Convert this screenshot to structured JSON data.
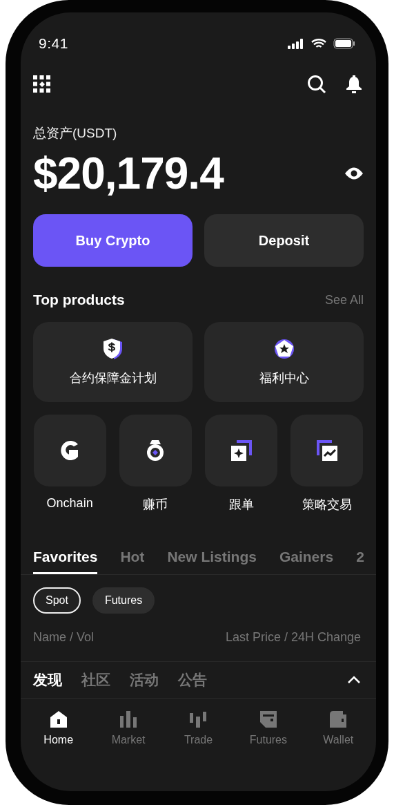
{
  "status_bar": {
    "time": "9:41"
  },
  "balance": {
    "label": "总资产(USDT)",
    "amount": "$20,179.4"
  },
  "actions": [
    {
      "label": "Buy Crypto",
      "kind": "primary"
    },
    {
      "label": "Deposit",
      "kind": "secondary"
    }
  ],
  "top_products": {
    "title": "Top products",
    "see_all": "See All",
    "featured": [
      {
        "label": "合约保障金计划"
      },
      {
        "label": "福利中心"
      }
    ],
    "shortcuts": [
      {
        "label": "Onchain"
      },
      {
        "label": "赚币"
      },
      {
        "label": "跟单"
      },
      {
        "label": "策略交易"
      }
    ]
  },
  "market_tabs": [
    {
      "label": "Favorites",
      "selected": true
    },
    {
      "label": "Hot",
      "selected": false
    },
    {
      "label": "New Listings",
      "selected": false
    },
    {
      "label": "Gainers",
      "selected": false
    },
    {
      "label": "2",
      "selected": false
    }
  ],
  "filters": [
    {
      "label": "Spot",
      "selected": true
    },
    {
      "label": "Futures",
      "selected": false
    }
  ],
  "columns": [
    "Name / Vol",
    "Last Price / 24H Change"
  ],
  "discover_tabs": [
    {
      "label": "发现",
      "selected": true
    },
    {
      "label": "社区",
      "selected": false
    },
    {
      "label": "活动",
      "selected": false
    },
    {
      "label": "公告",
      "selected": false
    }
  ],
  "bottom_nav": [
    {
      "label": "Home",
      "selected": true
    },
    {
      "label": "Market",
      "selected": false
    },
    {
      "label": "Trade",
      "selected": false
    },
    {
      "label": "Futures",
      "selected": false
    },
    {
      "label": "Wallet",
      "selected": false
    }
  ]
}
